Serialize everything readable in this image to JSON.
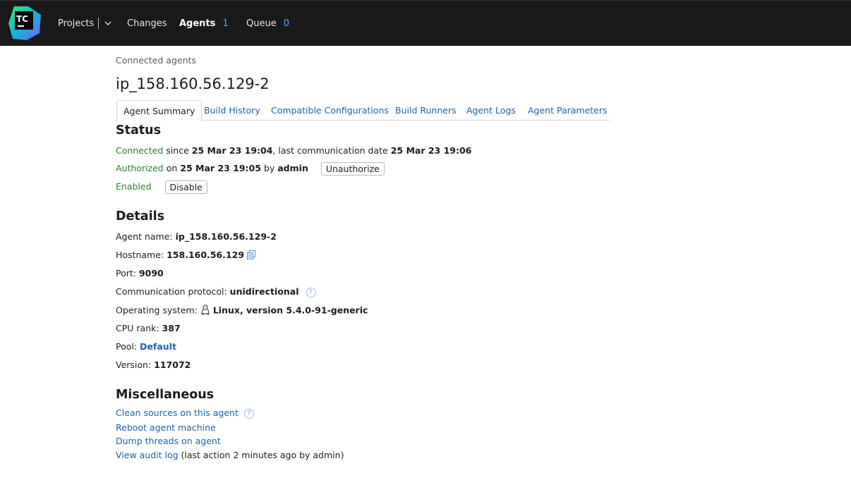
{
  "header": {
    "logo_text": "TC",
    "nav": {
      "projects": "Projects",
      "changes": "Changes",
      "agents": "Agents",
      "agents_count": "1",
      "queue": "Queue",
      "queue_count": "0"
    }
  },
  "breadcrumb": "Connected agents",
  "agent_title": "ip_158.160.56.129-2",
  "tabs": [
    "Agent Summary",
    "Build History",
    "Compatible Configurations",
    "Build Runners",
    "Agent Logs",
    "Agent Parameters"
  ],
  "status": {
    "heading": "Status",
    "connected_label": "Connected",
    "since_text": " since ",
    "connected_date": "25 Mar 23 19:04",
    "last_comm_text": ", last communication date ",
    "last_comm_date": "25 Mar 23 19:06",
    "authorized_label": "Authorized",
    "on_text": " on ",
    "authorized_date": "25 Mar 23 19:05",
    "by_text": " by ",
    "authorized_by": "admin",
    "unauthorize_button": "Unauthorize",
    "enabled_label": "Enabled",
    "disable_button": "Disable"
  },
  "details": {
    "heading": "Details",
    "agent_name_label": "Agent name: ",
    "agent_name": "ip_158.160.56.129-2",
    "hostname_label": "Hostname: ",
    "hostname": "158.160.56.129",
    "port_label": "Port: ",
    "port": "9090",
    "protocol_label": "Communication protocol: ",
    "protocol": "unidirectional",
    "os_label": "Operating system: ",
    "os": "Linux, version 5.4.0-91-generic",
    "cpu_label": "CPU rank: ",
    "cpu": "387",
    "pool_label": "Pool: ",
    "pool": "Default",
    "version_label": "Version: ",
    "version": "117072"
  },
  "misc": {
    "heading": "Miscellaneous",
    "clean_sources": "Clean sources on this agent",
    "reboot": "Reboot agent machine",
    "dump_threads": "Dump threads on agent",
    "audit_log": "View audit log",
    "audit_note": " (last action 2 minutes ago by admin)"
  },
  "icons": {
    "help": "?",
    "copy": "copy-icon",
    "os": "linux-penguin-icon",
    "chevron": "chevron-down-icon"
  },
  "colors": {
    "topbar": "#19191c",
    "link": "#1d63a8",
    "status_green": "#2d7f2d",
    "counter": "#4fa5ff"
  }
}
